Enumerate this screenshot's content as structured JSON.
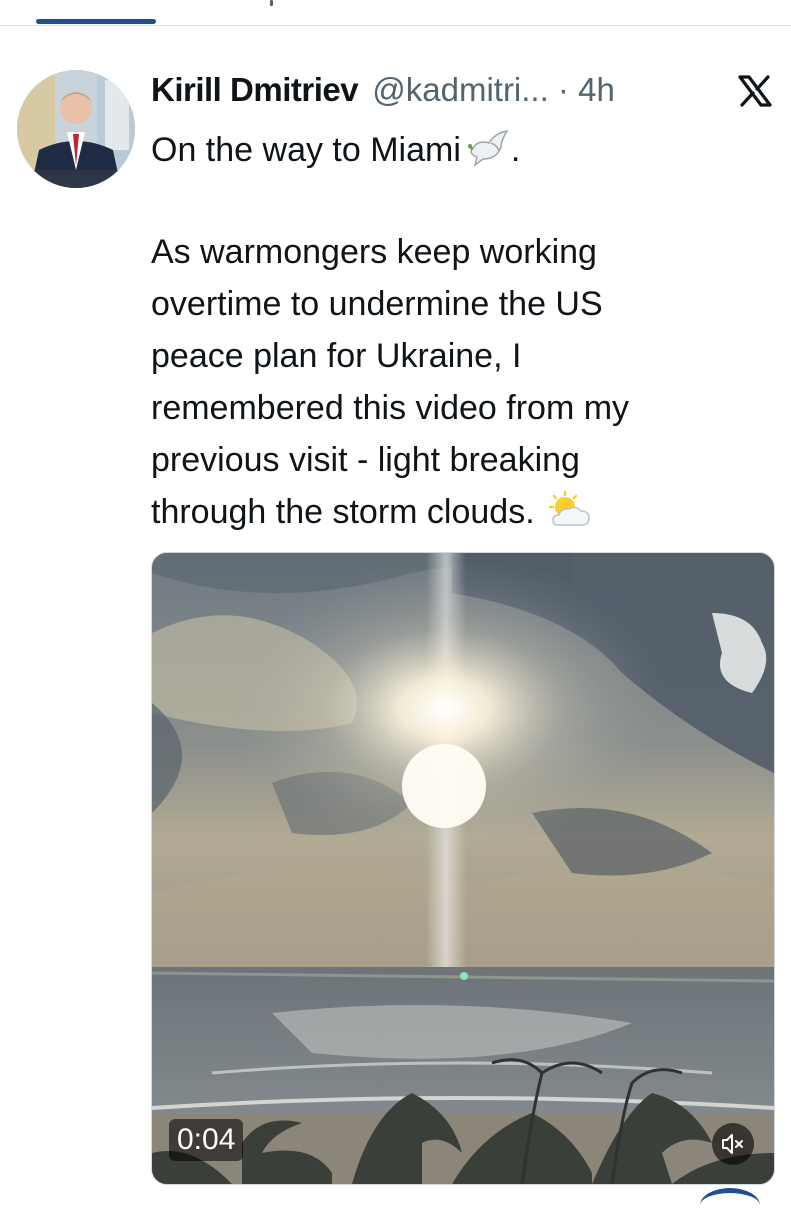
{
  "post": {
    "author_name": "Kirill Dmitriev",
    "author_handle": "@kadmitri...",
    "separator": "·",
    "timestamp": "4h",
    "text_lines": [
      "On the way to Miami",
      "As warmongers keep working",
      "overtime to undermine the US",
      "peace plan for Ukraine, I",
      "remembered this video from my",
      "previous visit - light breaking",
      "through the storm clouds."
    ],
    "first_line_suffix": ".",
    "emoji": [
      "dove-icon",
      "sun-behind-cloud-icon"
    ]
  },
  "video": {
    "duration": "0:04",
    "muted": true,
    "icons": [
      "speaker-muted-icon"
    ]
  },
  "colors": {
    "text_primary": "#0f1419",
    "text_secondary": "#536471",
    "accent": "#1d4f91"
  },
  "icons": [
    "x-logo-icon",
    "avatar"
  ]
}
